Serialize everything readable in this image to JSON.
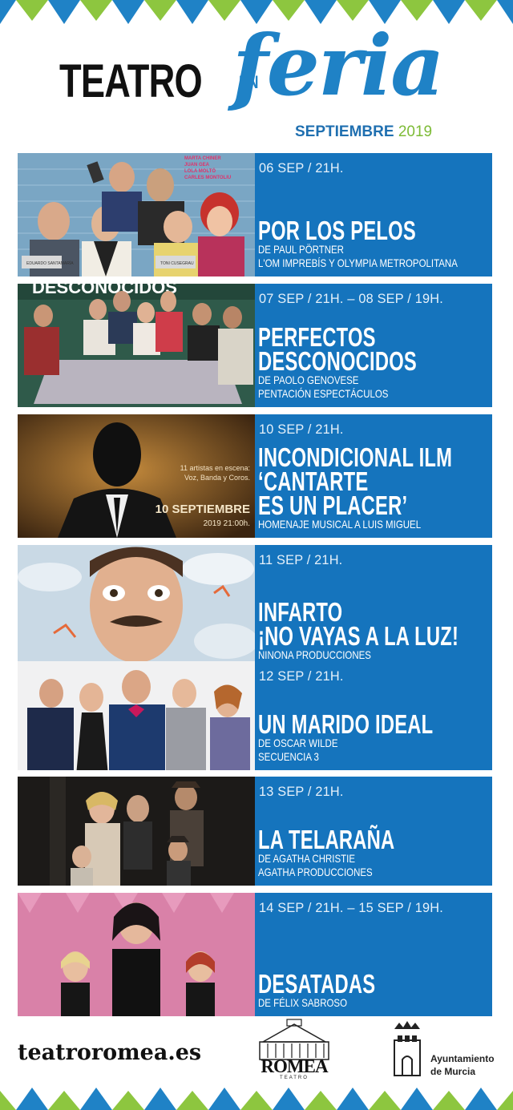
{
  "brand": {
    "teatro": "TEATRO",
    "en": "EN",
    "feria": "feria",
    "month": "SEPTIEMBRE",
    "year": "2019",
    "colors": {
      "blue": "#1574bd",
      "accent_blue": "#1f82c6",
      "green": "#7dbb36"
    }
  },
  "events": [
    {
      "when": "06 SEP / 21H.",
      "title": "POR LOS PELOS",
      "lines": [
        "DE PAUL PÖRTNER",
        "L'OM IMPREBÍS Y OLYMPIA METROPOLITANA"
      ]
    },
    {
      "when": "07 SEP / 21H. – 08 SEP / 19H.",
      "title": "PERFECTOS\nDESCONOCIDOS",
      "lines": [
        "DE PAOLO GENOVESE",
        "PENTACIÓN ESPECTÁCULOS"
      ]
    },
    {
      "when": "10 SEP / 21H.",
      "title": "INCONDICIONAL ILM\n‘CANTARTE\nES UN PLACER’",
      "lines": [
        "HOMENAJE MUSICAL A LUIS MIGUEL"
      ]
    },
    {
      "when": "11 SEP / 21H.",
      "title": "INFARTO\n¡NO VAYAS A LA LUZ!",
      "lines": [
        "NINONA PRODUCCIONES"
      ]
    },
    {
      "when": "12 SEP / 21H.",
      "title": "UN MARIDO IDEAL",
      "lines": [
        "DE OSCAR WILDE",
        "SECUENCIA 3"
      ]
    },
    {
      "when": "13 SEP / 21H.",
      "title": "LA TELARAÑA",
      "lines": [
        "DE AGATHA CHRISTIE",
        "AGATHA PRODUCCIONES"
      ]
    },
    {
      "when": "14 SEP / 21H. – 15 SEP / 19H.",
      "title": "DESATADAS",
      "lines": [
        "DE FÉLIX SABROSO"
      ]
    }
  ],
  "posters": {
    "p1_cast": [
      "MARTA CHINER",
      "JUAN GEA",
      "LOLA MOLTÓ",
      "CARLES MONTOLIU"
    ],
    "p1_tags": [
      "EDUARDO SANTAMARÍA",
      "TONI CUSEGRAU"
    ],
    "p2_top": "DESCONOCIDOS",
    "p3_lines": [
      "11 artistas en escena:",
      "Voz, Banda y Coros."
    ],
    "p3_date": "10 SEPTIEMBRE",
    "p3_time": "2019 21:00h."
  },
  "footer": {
    "url": "teatroromea.es",
    "romea": "ROMEA",
    "romea_sub": "TEATRO",
    "ayto_line1": "Ayuntamiento",
    "ayto_line2": "de Murcia"
  }
}
